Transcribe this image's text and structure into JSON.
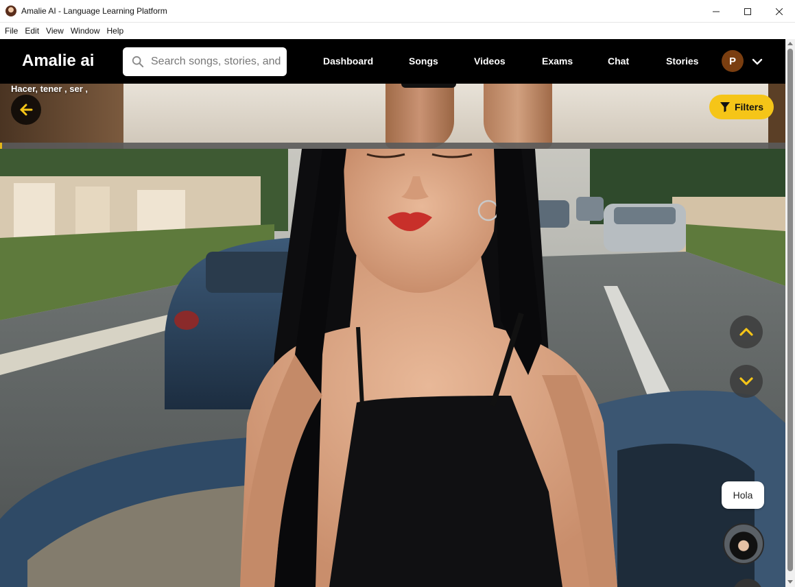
{
  "window": {
    "title": "Amalie AI - Language Learning Platform",
    "controls": [
      "minimize",
      "maximize",
      "close"
    ]
  },
  "menubar": {
    "items": [
      "File",
      "Edit",
      "View",
      "Window",
      "Help"
    ]
  },
  "header": {
    "logo": "Amalie ai",
    "search_placeholder": "Search songs, stories, and",
    "nav": [
      "Dashboard",
      "Songs",
      "Videos",
      "Exams",
      "Chat",
      "Stories"
    ],
    "user_initial": "P"
  },
  "video": {
    "title": "Hacer, tener , ser ,",
    "filters_label": "Filters",
    "progress_fraction": 0.003
  },
  "assistant": {
    "greeting": "Hola"
  },
  "colors": {
    "accent": "#f5c518",
    "header_bg": "#000000",
    "user_avatar": "#7a3e10"
  }
}
